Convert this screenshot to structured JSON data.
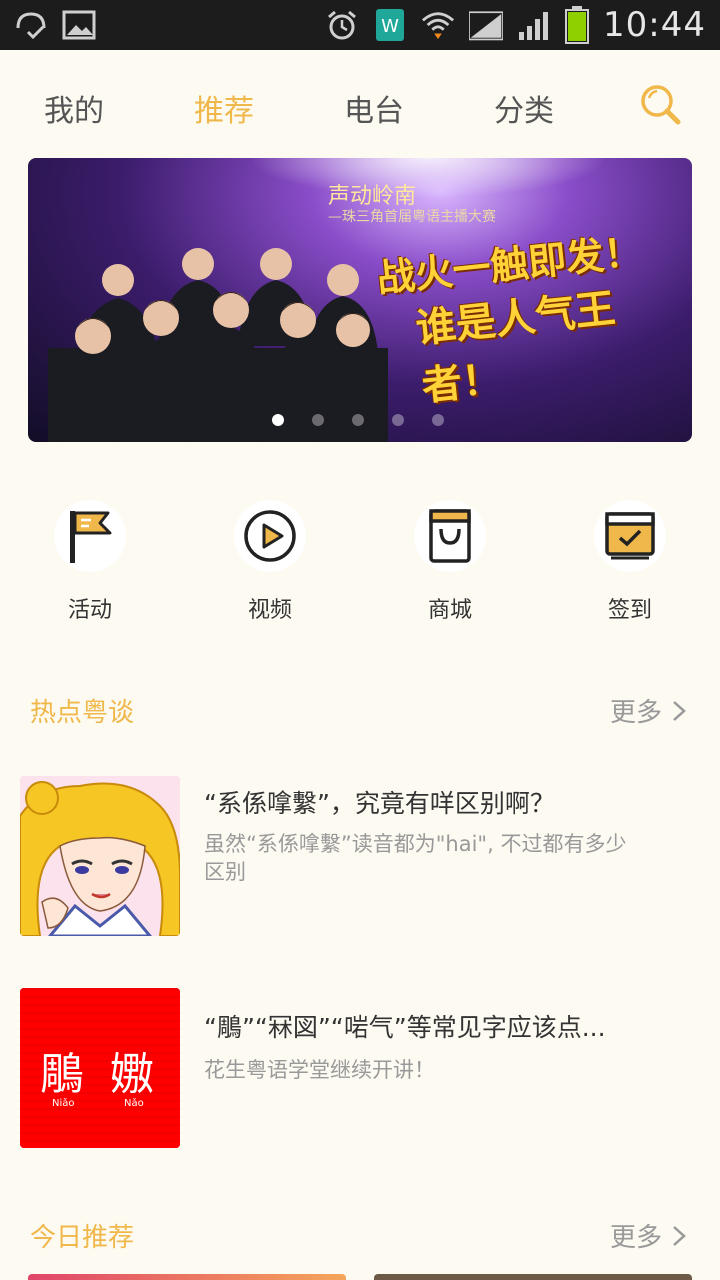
{
  "status_bar": {
    "time": "10:44",
    "icons": [
      "missed-call-icon",
      "gallery-icon",
      "alarm-icon",
      "wps-app-icon",
      "wifi-icon",
      "signal-icon",
      "signal-icon",
      "battery-icon"
    ]
  },
  "nav": {
    "tabs": [
      {
        "label": "我的",
        "active": false
      },
      {
        "label": "推荐",
        "active": true
      },
      {
        "label": "电台",
        "active": false
      },
      {
        "label": "分类",
        "active": false
      }
    ]
  },
  "banner": {
    "title": "声动岭南",
    "subtitle": "—珠三角首届粤语主播大赛",
    "slogan_line1": "战火一触即发！",
    "slogan_line2": "谁是人气王者！",
    "slide_count": 5,
    "active_slide": 1
  },
  "quick_actions": [
    {
      "label": "活动",
      "icon": "flag-icon"
    },
    {
      "label": "视频",
      "icon": "play-icon"
    },
    {
      "label": "商城",
      "icon": "shopping-bag-icon"
    },
    {
      "label": "签到",
      "icon": "checkin-icon"
    }
  ],
  "sections": {
    "hot": {
      "title": "热点粤谈",
      "more": "更多",
      "items": [
        {
          "title": "“系係嗱繫”，究竟有咩区别啊？",
          "desc": "虽然“系係嗱繫”读音都为\"hai\", 不过都有多少区别"
        },
        {
          "title": "“鵰”“冧図”“啱气”等常见字应该点...",
          "desc": "花生粤语学堂继续开讲！"
        }
      ],
      "thumb2_chars": [
        "鵰",
        "嫐"
      ],
      "thumb2_pinyin": [
        "Niǎo",
        "Nǎo"
      ]
    },
    "today": {
      "title": "今日推荐",
      "more": "更多"
    }
  },
  "colors": {
    "accent": "#f0b84b",
    "background": "#fdfaf2",
    "status_bar": "#1c1c1c"
  }
}
